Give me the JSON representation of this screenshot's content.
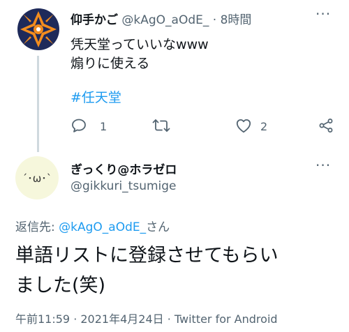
{
  "tweet1": {
    "display_name": "仰手かご",
    "handle": "@kAgO_aOdE_",
    "separator": "·",
    "time": "8時間",
    "more_label": "···",
    "text_line1": "凭天堂っていいなwww",
    "text_line2": "煽りに使える",
    "hashtag": "#任天堂",
    "reply_count": "1",
    "like_count": "2",
    "icons": [
      "reply-icon",
      "retweet-icon",
      "like-icon",
      "share-icon"
    ]
  },
  "tweet2": {
    "display_name": "ぎっくり@ホラゼロ",
    "handle": "@gikkuri_tsumige",
    "avatar_face": "´･ω･`",
    "more_label": "···",
    "reply_label": "返信先:",
    "reply_handle": "@kAgO_aOdE_",
    "reply_suffix": "さん",
    "body_line1": "単語リストに登録させてもらい",
    "body_line2": "ました(笑)",
    "timestamp": "午前11:59 · 2021年4月24日 · Twitter for Android"
  },
  "colors": {
    "link": "#1d9bf0",
    "secondary_text": "#536471",
    "thread_line": "#cfd9de",
    "avatar1_bg": "#1e2a5a",
    "avatar1_accent": "#f28c1e",
    "avatar2_bg": "#f6f7dc"
  }
}
